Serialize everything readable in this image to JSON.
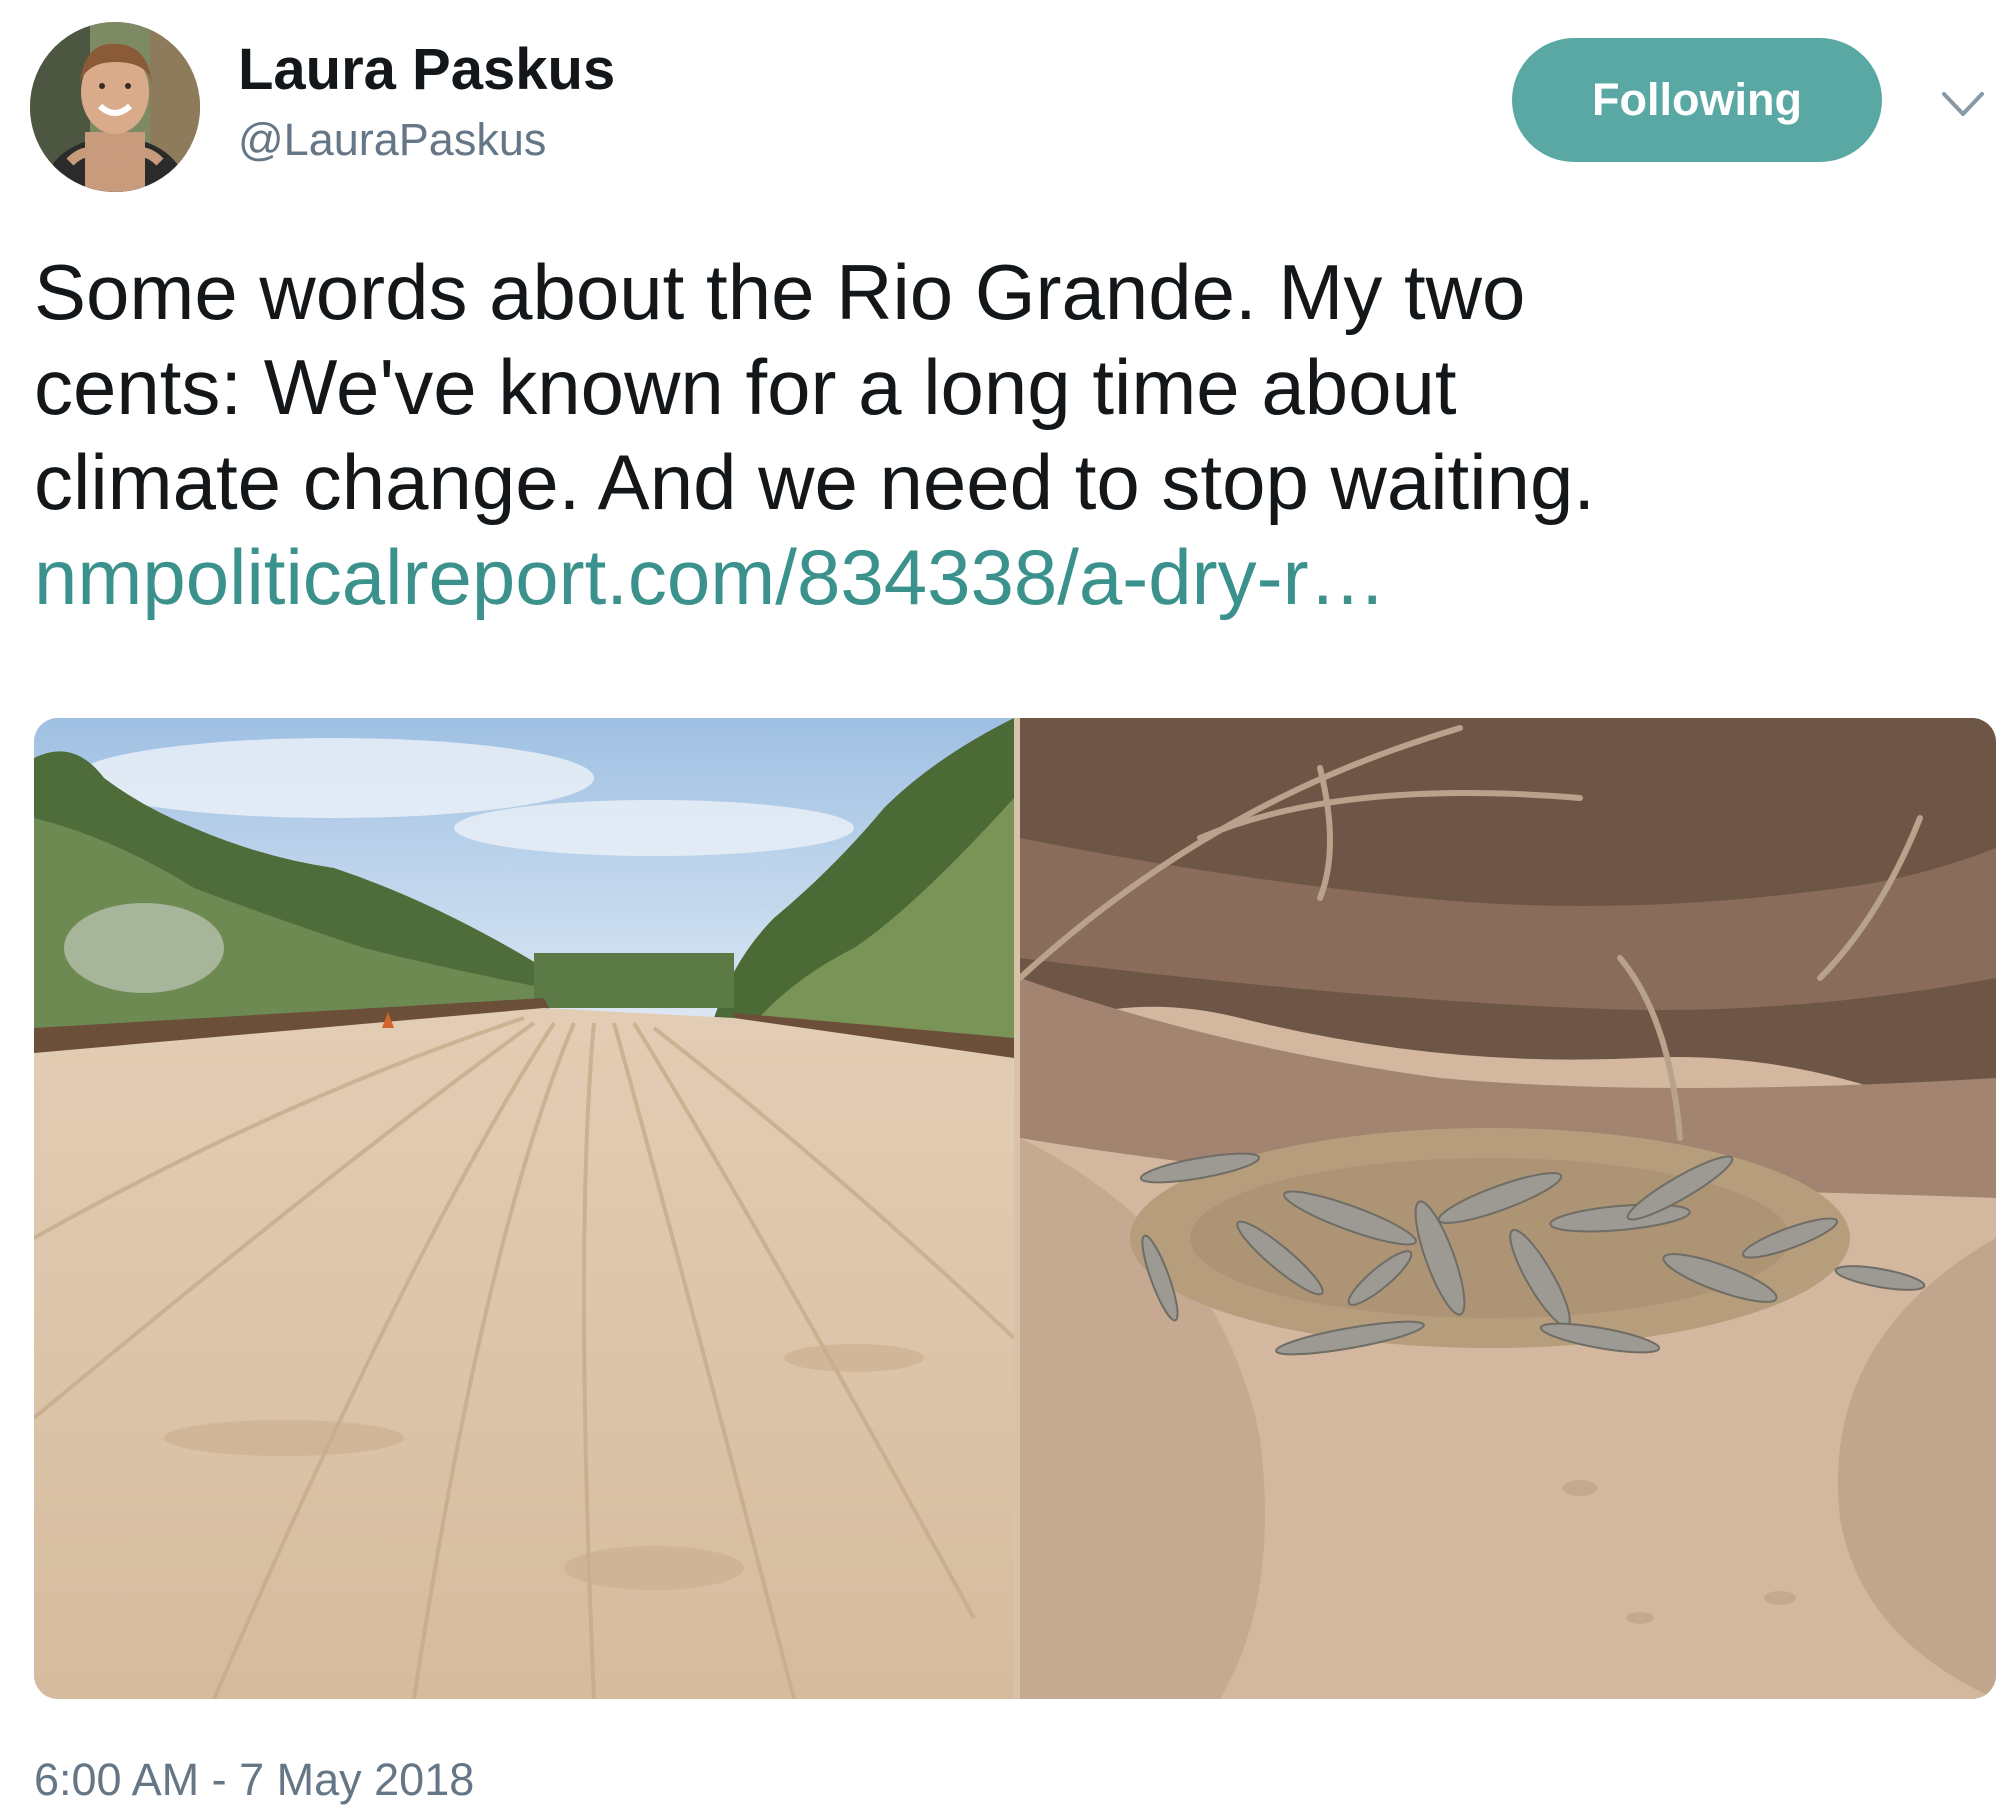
{
  "tweet": {
    "author": {
      "display_name": "Laura Paskus",
      "handle": "@LauraPaskus"
    },
    "follow_button_label": "Following",
    "text_lines": [
      "Some words about the Rio Grande. My two",
      "cents: We've known for a long time about",
      "climate change. And we need to stop waiting."
    ],
    "link_text": "nmpoliticalreport.com/834338/a-dry-r…",
    "media": [
      {
        "icon": "photo-dry-riverbed"
      },
      {
        "icon": "photo-dead-fish-on-bank"
      }
    ],
    "timestamp": "6:00 AM - 7 May 2018"
  },
  "colors": {
    "follow_button": "#5aa8a4",
    "link": "#3b918c",
    "secondary_text": "#657786",
    "primary_text": "#14171a"
  }
}
